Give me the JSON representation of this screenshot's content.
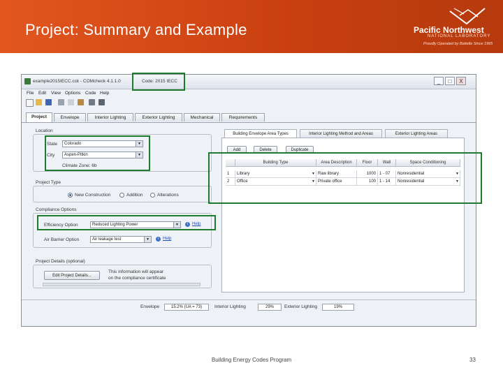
{
  "slide": {
    "title": "Project: Summary and Example",
    "footer": "Building Energy Codes Program",
    "page_number": "33",
    "logo": {
      "name": "Pacific Northwest",
      "subtitle": "NATIONAL LABORATORY",
      "tagline": "Proudly Operated by Battelle Since 1965"
    },
    "colors": {
      "banner": "#d24a17",
      "highlight": "#1e7a2e"
    }
  },
  "app": {
    "window_title": "example2015IECC.cck - COMcheck 4.1.1.0",
    "code_label": "Code: 2015 IECC",
    "window_buttons": [
      "_",
      "□",
      "X"
    ],
    "menu": [
      "File",
      "Edit",
      "View",
      "Options",
      "Code",
      "Help"
    ],
    "tabs": [
      "Project",
      "Envelope",
      "Interior Lighting",
      "Exterior Lighting",
      "Mechanical",
      "Requirements"
    ],
    "location": {
      "title": "Location",
      "state_label": "State",
      "state_value": "Colorado",
      "city_label": "City",
      "city_value": "Aspen-Pitkin",
      "climate_text": "Climate Zone: 6b"
    },
    "project_type": {
      "title": "Project Type",
      "options": [
        "New Construction",
        "Addition",
        "Alterations"
      ],
      "selected": "New Construction"
    },
    "compliance": {
      "title": "Compliance Options",
      "efficiency_label": "Efficiency Option",
      "efficiency_value": "Reduced Lighting Power",
      "air_barrier_label": "Air Barrier Option",
      "air_barrier_value": "Air leakage test",
      "help": "Help"
    },
    "project_details": {
      "title": "Project Details (optional)",
      "button": "Edit Project Details...",
      "note_line1": "This information will appear",
      "note_line2": "on the compliance certificate"
    },
    "right_tabs": [
      "Building Envelope Area Types",
      "Interior Lighting Method and Areas",
      "Exterior Lighting Areas"
    ],
    "area_buttons": [
      "Add",
      "Delete",
      "Duplicate"
    ],
    "table": {
      "columns": [
        "",
        "Building Type",
        "Area Description",
        "Floor",
        "Wall",
        "Space Conditioning"
      ],
      "rows": [
        [
          "1",
          "Library",
          "Raw library",
          "1000",
          "1 - 07",
          "Nonresidential"
        ],
        [
          "2",
          "Office",
          "Private office",
          "100",
          "1 - 14",
          "Nonresidential"
        ]
      ]
    },
    "status": {
      "envelope_label": "Envelope",
      "envelope_value": "15.2% (UA = 73)",
      "interior_label": "Interior Lighting",
      "interior_value": "29%",
      "exterior_label": "Exterior Lighting",
      "exterior_value": "19%"
    }
  }
}
